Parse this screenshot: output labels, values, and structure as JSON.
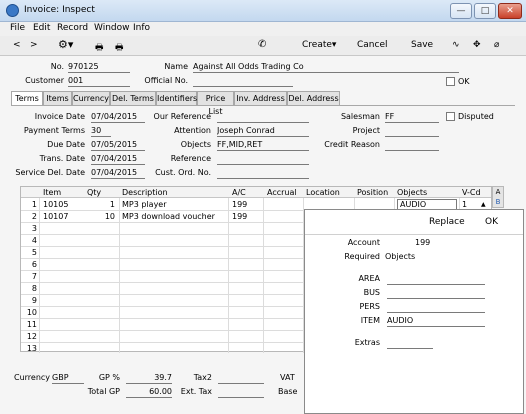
{
  "window": {
    "title": "Invoice: Inspect",
    "btn_min": "—",
    "btn_max": "□",
    "btn_close": "✕"
  },
  "menu": [
    "File",
    "Edit",
    "Record",
    "Window",
    "Info"
  ],
  "toolbar": {
    "prev": "<",
    "next": ">",
    "create": "Create",
    "cancel": "Cancel",
    "save": "Save"
  },
  "header": {
    "no_label": "No.",
    "no_value": "970125",
    "name_label": "Name",
    "name_value": "Against All Odds Trading Co",
    "customer_label": "Customer",
    "customer_value": "001",
    "official_label": "Official No.",
    "official_value": "",
    "ok_label": "OK"
  },
  "tabs": [
    "Terms",
    "Items",
    "Currency",
    "Del. Terms",
    "Identifiers",
    "Price List",
    "Inv. Address",
    "Del. Address"
  ],
  "terms": {
    "invoice_date_label": "Invoice Date",
    "invoice_date": "07/04/2015",
    "payment_terms_label": "Payment Terms",
    "payment_terms": "30",
    "due_date_label": "Due Date",
    "due_date": "07/05/2015",
    "trans_date_label": "Trans. Date",
    "trans_date": "07/04/2015",
    "service_del_label": "Service Del. Date",
    "service_del": "07/04/2015",
    "our_ref_label": "Our Reference",
    "our_ref": "",
    "attention_label": "Attention",
    "attention": "Joseph Conrad",
    "objects_label": "Objects",
    "objects": "FF,MID,RET",
    "reference_label": "Reference",
    "reference": "",
    "cust_ord_label": "Cust. Ord. No.",
    "cust_ord": "",
    "salesman_label": "Salesman",
    "salesman": "FF",
    "disputed_label": "Disputed",
    "project_label": "Project",
    "project": "",
    "credit_reason_label": "Credit Reason",
    "credit_reason": ""
  },
  "grid": {
    "columns": [
      "Item",
      "Qty",
      "Description",
      "A/C",
      "Accrual",
      "Location",
      "Position",
      "Objects",
      "V-Cd"
    ],
    "rows": [
      {
        "n": "1",
        "item": "10105",
        "qty": "1",
        "desc": "MP3 player",
        "ac": "199",
        "objects": "AUDIO",
        "vcd": "1"
      },
      {
        "n": "2",
        "item": "10107",
        "qty": "10",
        "desc": "MP3 download voucher",
        "ac": "199",
        "objects": "",
        "vcd": ""
      },
      {
        "n": "3"
      },
      {
        "n": "4"
      },
      {
        "n": "5"
      },
      {
        "n": "6"
      },
      {
        "n": "7"
      },
      {
        "n": "8"
      },
      {
        "n": "9"
      },
      {
        "n": "10"
      },
      {
        "n": "11"
      },
      {
        "n": "12"
      },
      {
        "n": "13"
      }
    ],
    "side_a": "A",
    "side_b": "B"
  },
  "popup": {
    "replace": "Replace",
    "ok": "OK",
    "account_label": "Account",
    "account": "199",
    "required_label": "Required",
    "required": "Objects",
    "area_label": "AREA",
    "area": "",
    "bus_label": "BUS",
    "bus": "",
    "pers_label": "PERS",
    "pers": "",
    "item_label": "ITEM",
    "item": "AUDIO",
    "extras_label": "Extras",
    "extras": ""
  },
  "footer": {
    "currency_label": "Currency",
    "currency": "GBP",
    "gp_pct_label": "GP %",
    "gp_pct": "39.7",
    "total_gp_label": "Total GP",
    "total_gp": "60.00",
    "tax2_label": "Tax2",
    "tax2": "",
    "ext_tax_label": "Ext. Tax",
    "ext_tax": "",
    "vat_label": "VAT",
    "base_label": "Base"
  }
}
